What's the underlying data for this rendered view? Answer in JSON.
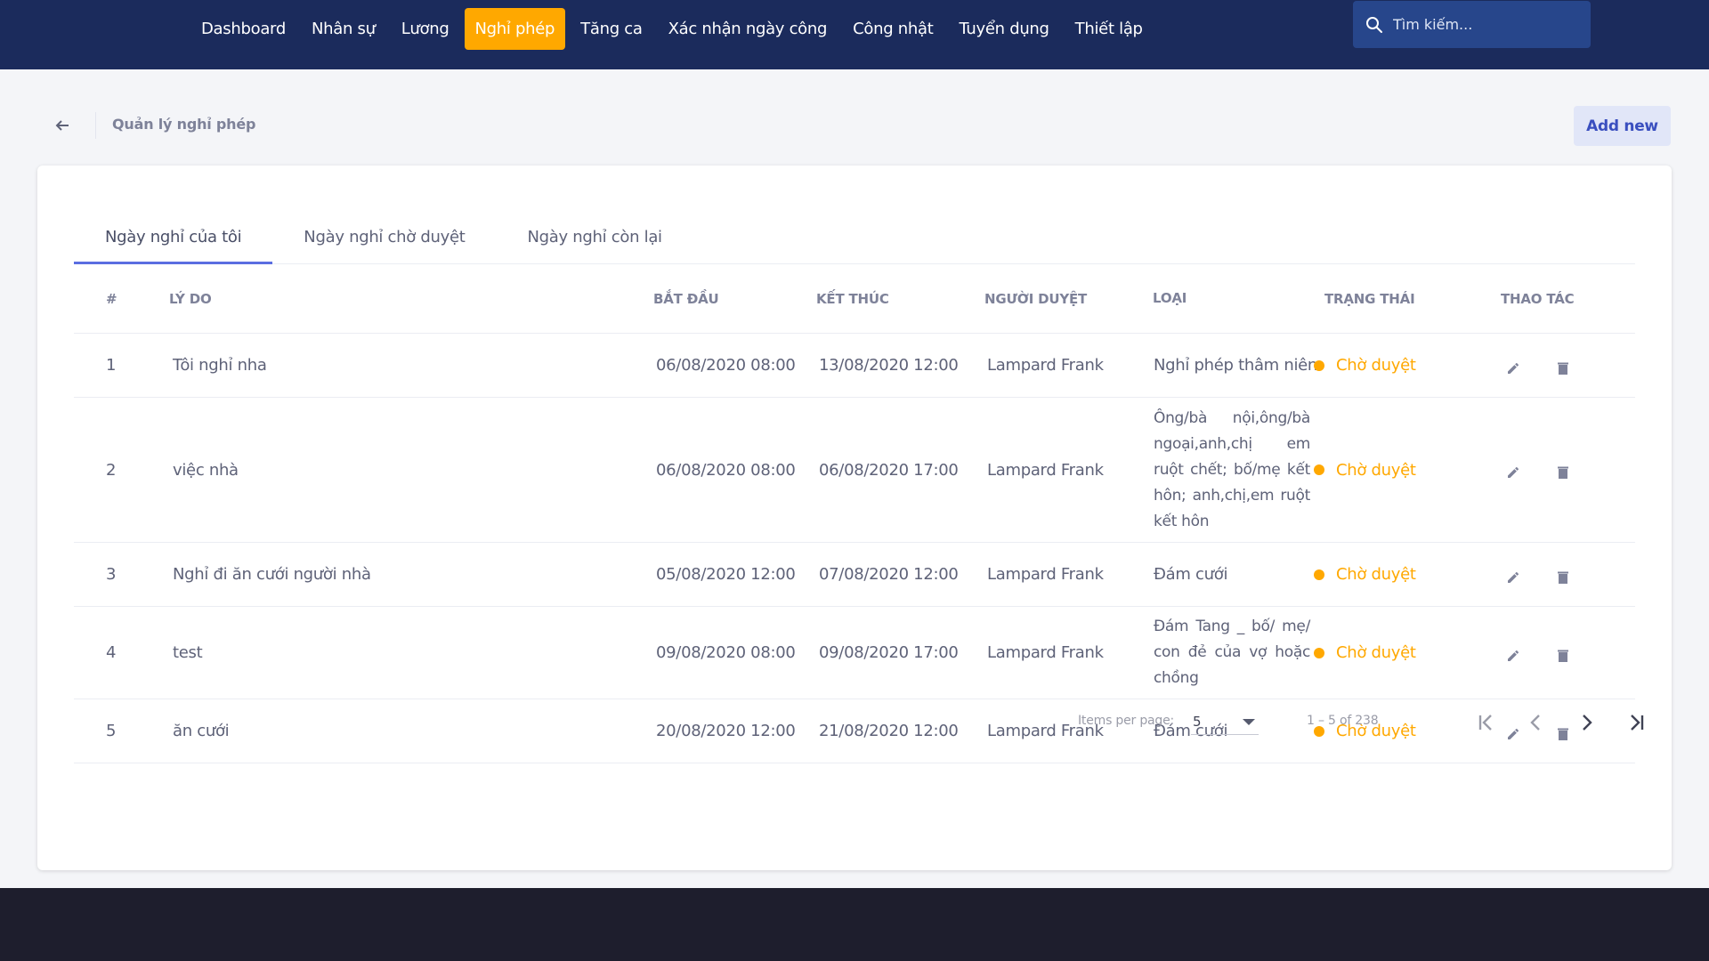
{
  "nav": {
    "items": [
      {
        "label": "Dashboard",
        "active": false
      },
      {
        "label": "Nhân sự",
        "active": false
      },
      {
        "label": "Lương",
        "active": false
      },
      {
        "label": "Nghỉ phép",
        "active": true
      },
      {
        "label": "Tăng ca",
        "active": false
      },
      {
        "label": "Xác nhận ngày công",
        "active": false
      },
      {
        "label": "Công nhật",
        "active": false
      },
      {
        "label": "Tuyển dụng",
        "active": false
      },
      {
        "label": "Thiết lập",
        "active": false
      }
    ],
    "search": {
      "placeholder": "Tìm kiếm...",
      "value": ""
    }
  },
  "subheader": {
    "title": "Quản lý nghỉ phép",
    "add_label": "Add new"
  },
  "tabs": [
    {
      "label": "Ngày nghỉ của tôi",
      "active": true
    },
    {
      "label": "Ngày nghỉ chờ duyệt",
      "active": false
    },
    {
      "label": "Ngày nghỉ còn lại",
      "active": false
    }
  ],
  "table": {
    "headers": {
      "num": "#",
      "reason": "LÝ DO",
      "start": "BẮT ĐẦU",
      "end": "KẾT THÚC",
      "approver": "NGƯỜI DUYỆT",
      "type": "LOẠI",
      "status": "TRẠNG THÁI",
      "actions": "THAO TÁC"
    },
    "rows": [
      {
        "num": "1",
        "reason": "Tôi nghỉ nha",
        "start": "06/08/2020 08:00",
        "end": "13/08/2020 12:00",
        "approver": "Lampard Frank",
        "type": "Nghỉ phép thâm niên",
        "status": "Chờ duyệt"
      },
      {
        "num": "2",
        "reason": "việc nhà",
        "start": "06/08/2020 08:00",
        "end": "06/08/2020 17:00",
        "approver": "Lampard Frank",
        "type": "Ông/bà nội,ông/bà ngoại,anh,chị em ruột chết; bố/mẹ kết hôn; anh,chị,em ruột kết hôn",
        "status": "Chờ duyệt"
      },
      {
        "num": "3",
        "reason": "Nghỉ đi ăn cưới người nhà",
        "start": "05/08/2020 12:00",
        "end": "07/08/2020 12:00",
        "approver": "Lampard Frank",
        "type": "Đám cưới",
        "status": "Chờ duyệt"
      },
      {
        "num": "4",
        "reason": "test",
        "start": "09/08/2020 08:00",
        "end": "09/08/2020 17:00",
        "approver": "Lampard Frank",
        "type": "Đám Tang _ bố/ mẹ/ con đẻ của vợ hoặc chồng",
        "status": "Chờ duyệt"
      },
      {
        "num": "5",
        "reason": "ăn cưới",
        "start": "20/08/2020 12:00",
        "end": "21/08/2020 12:00",
        "approver": "Lampard Frank",
        "type": "Đám cưới",
        "status": "Chờ duyệt"
      }
    ]
  },
  "paginator": {
    "items_per_page_label": "Items per page:",
    "items_per_page": "5",
    "range": "1 – 5 of 238"
  },
  "colors": {
    "navbar": "#1b2b5c",
    "active_nav": "#ffa800",
    "status_pending": "#ffa800",
    "tab_underline": "#5b6ee1",
    "footer": "#1e1e2d"
  }
}
